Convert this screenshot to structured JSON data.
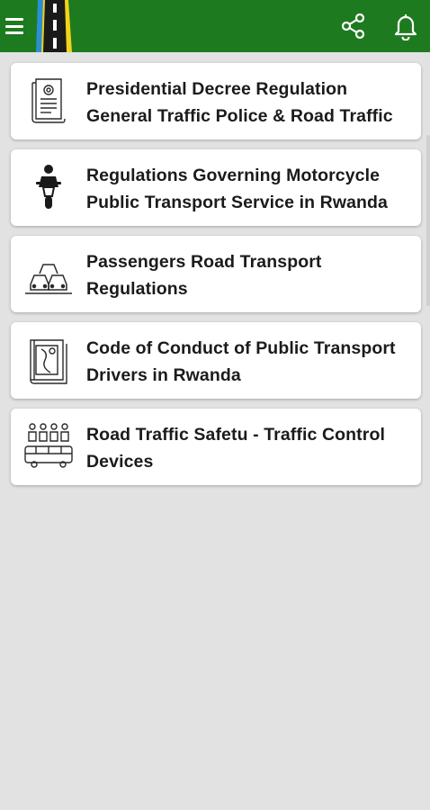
{
  "appbar": {
    "background": "#1e7a1e",
    "menu_icon": "hamburger-menu-icon",
    "logo_icon": "road-logo-icon",
    "share_icon": "share-icon",
    "bell_icon": "bell-icon"
  },
  "items": [
    {
      "title": "Presidential Decree Regulation General Traffic Police & Road Traffic",
      "icon": "decree-document-icon"
    },
    {
      "title": "Regulations Governing Motorcycle Public Transport Service in Rwanda",
      "icon": "motorcycle-rider-icon"
    },
    {
      "title": "Passengers Road Transport Regulations",
      "icon": "cars-traffic-icon"
    },
    {
      "title": "Code of Conduct of Public Transport Drivers in Rwanda",
      "icon": "road-map-book-icon"
    },
    {
      "title": "Road Traffic Safetu - Traffic Control Devices",
      "icon": "pedestrians-bus-icon"
    }
  ]
}
